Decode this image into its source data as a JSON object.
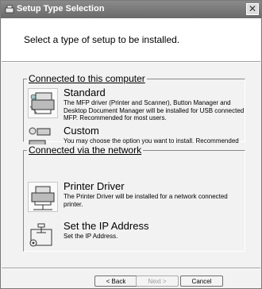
{
  "window": {
    "title": "Setup Type Selection",
    "close_glyph": "✕"
  },
  "prompt": "Select a type of setup to be installed.",
  "groups": [
    {
      "label": "Connected to this computer",
      "options": [
        {
          "title": "Standard",
          "icon": "printer-scanner-icon",
          "description": "The MFP driver (Printer and Scanner), Button Manager and Desktop Document Manager will be installed for USB connected MFP. Recommended for most users."
        },
        {
          "title": "Custom",
          "icon": "custom-setup-icon",
          "description": "You may choose the option you want to install. Recommended for advanced users."
        }
      ]
    },
    {
      "label": "Connected via the network",
      "options": [
        {
          "title": "Printer Driver",
          "icon": "network-printer-icon",
          "description": "The Printer Driver will be installed for a network connected printer."
        },
        {
          "title": "Set the IP Address",
          "icon": "ip-address-icon",
          "description": "Set the IP Address."
        }
      ]
    }
  ],
  "buttons": {
    "back": "< Back",
    "next": "Next >",
    "cancel": "Cancel"
  }
}
